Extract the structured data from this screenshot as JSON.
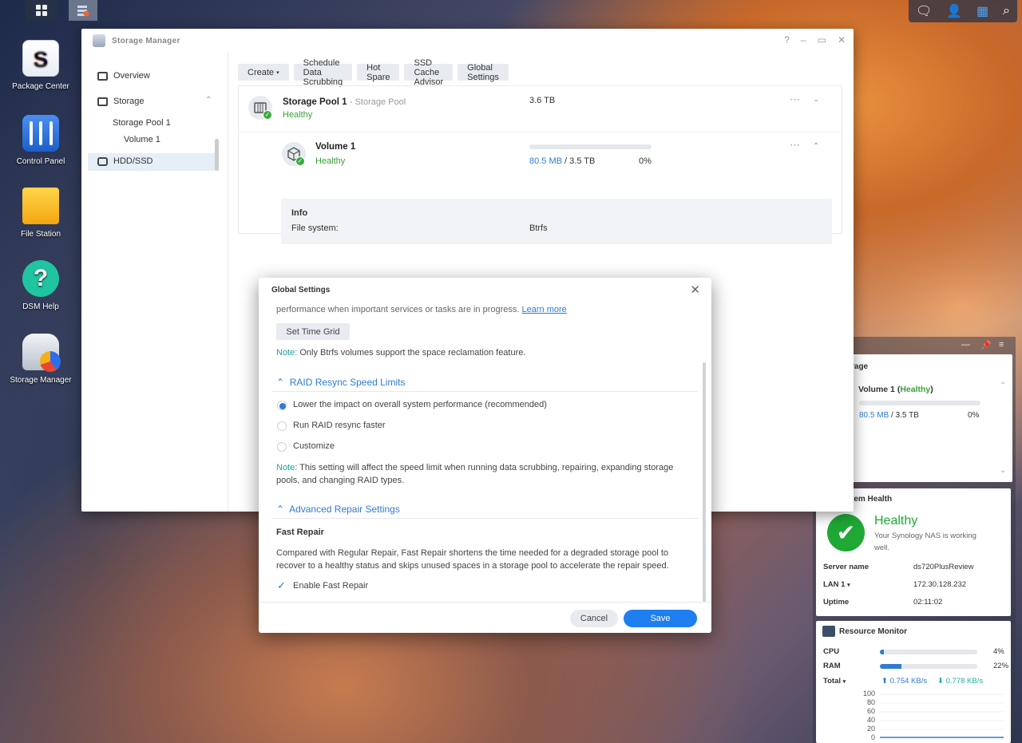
{
  "taskbar": {
    "icons": [
      "grid-icon",
      "apps-icon"
    ],
    "right_icons": [
      "chat-icon",
      "user-icon",
      "widgets-icon",
      "search-icon"
    ]
  },
  "desktop": {
    "icons": [
      {
        "label": "Package Center",
        "icon": "package-center-icon"
      },
      {
        "label": "Control Panel",
        "icon": "control-panel-icon"
      },
      {
        "label": "File Station",
        "icon": "folder-icon"
      },
      {
        "label": "DSM Help",
        "icon": "help-icon"
      },
      {
        "label": "Storage Manager",
        "icon": "storage-manager-icon"
      }
    ]
  },
  "window": {
    "title": "Storage Manager",
    "controls": [
      "?",
      "–",
      "▭",
      "✕"
    ],
    "sidebar": {
      "overview": "Overview",
      "storage": "Storage",
      "pool": "Storage Pool 1",
      "volume": "Volume 1",
      "hdd": "HDD/SSD"
    },
    "toolbar": {
      "create": "Create",
      "scrub": "Schedule Data Scrubbing",
      "hotspare": "Hot Spare",
      "ssd": "SSD Cache Advisor",
      "global": "Global Settings"
    },
    "pool": {
      "name": "Storage Pool 1",
      "type": "- Storage Pool",
      "status": "Healthy",
      "size": "3.6 TB"
    },
    "volume": {
      "name": "Volume 1",
      "status": "Healthy",
      "used": "80.5 MB",
      "total": "/ 3.5 TB",
      "percent": "0%",
      "usage_fraction": 0.0
    },
    "info": {
      "heading": "Info",
      "fs_label": "File system:",
      "fs_value": "Btrfs"
    }
  },
  "dialog": {
    "title": "Global Settings",
    "top_text": "performance when important services or tasks are in progress.",
    "learn_more": "Learn more",
    "time_grid_btn": "Set Time Grid",
    "note1_label": "Note:",
    "note1": "Only Btrfs volumes support the space reclamation feature.",
    "raid_heading": "RAID Resync Speed Limits",
    "opt1": "Lower the impact on overall system performance (recommended)",
    "opt2": "Run RAID resync faster",
    "opt3": "Customize",
    "note2_label": "Note:",
    "note2a": "This setting will affect the speed limit when running data scrubbing, repairing, expanding storage",
    "note2b": "pools, and changing RAID types.",
    "repair_heading": "Advanced Repair Settings",
    "fast_repair": "Fast Repair",
    "fast_desc_a": "Compared with Regular Repair, Fast Repair shortens the time needed for a degraded storage pool to",
    "fast_desc_b": "recover to a healthy status and skips unused spaces in a storage pool to accelerate the repair speed.",
    "enable_fast": "Enable Fast Repair",
    "cancel": "Cancel",
    "save": "Save"
  },
  "widgets": {
    "storage": {
      "title": "rage",
      "volume": "Volume 1",
      "paren_open": "(",
      "status": "Healthy",
      "paren_close": ")",
      "used": "80.5 MB",
      "total": "/ 3.5 TB",
      "percent": "0%"
    },
    "health": {
      "title": "tem Health",
      "status": "Healthy",
      "desc_a": "Your Synology NAS is working",
      "desc_b": "well.",
      "server_label": "Server name",
      "server": "ds720PlusReview",
      "lan_label": "LAN 1",
      "lan": "172.30.128.232",
      "uptime_label": "Uptime",
      "uptime": "02:11:02"
    },
    "resource": {
      "title": "Resource Monitor",
      "cpu_label": "CPU",
      "cpu": "4%",
      "cpu_fraction": 0.04,
      "ram_label": "RAM",
      "ram": "22%",
      "ram_fraction": 0.22,
      "total_label": "Total",
      "up": "0.754 KB/s",
      "down": "0.778 KB/s",
      "y_ticks": [
        "100",
        "80",
        "60",
        "40",
        "20",
        "0"
      ]
    }
  }
}
